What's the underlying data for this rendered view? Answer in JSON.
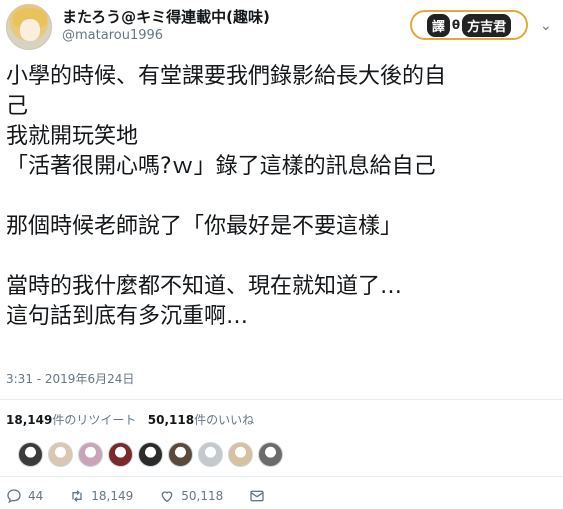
{
  "tweet": {
    "display_name": "またろう@キミ得連載中(趣味)",
    "handle": "@matarou1996",
    "badge": {
      "left": "譯",
      "dot": "θ",
      "right": "方吉君"
    },
    "lines": [
      "小學的時候、有堂課要我們錄影給長大後的自",
      "己",
      "我就開玩笑地",
      "「活著很開心嗎?ｗ」錄了這樣的訊息給自己",
      "",
      "那個時候老師說了「你最好是不要這樣」",
      "",
      "當時的我什麼都不知道、現在就知道了…",
      "這句話到底有多沉重啊…"
    ],
    "timestamp": "3:31 - 2019年6月24日",
    "retweet_count": "18,149",
    "retweet_label": "件のリツイート",
    "like_count": "50,118",
    "like_label": "件のいいね",
    "actions": {
      "reply_count": "44",
      "retweet_count": "18,149",
      "like_count": "50,118"
    }
  },
  "liker_colors": [
    "#3b3b3b",
    "#d9c7b0",
    "#c9a3b8",
    "#7a2a2a",
    "#2b2b2b",
    "#5a4a3a",
    "#c6c9cc",
    "#d7c1a0",
    "#6b6b6b"
  ]
}
